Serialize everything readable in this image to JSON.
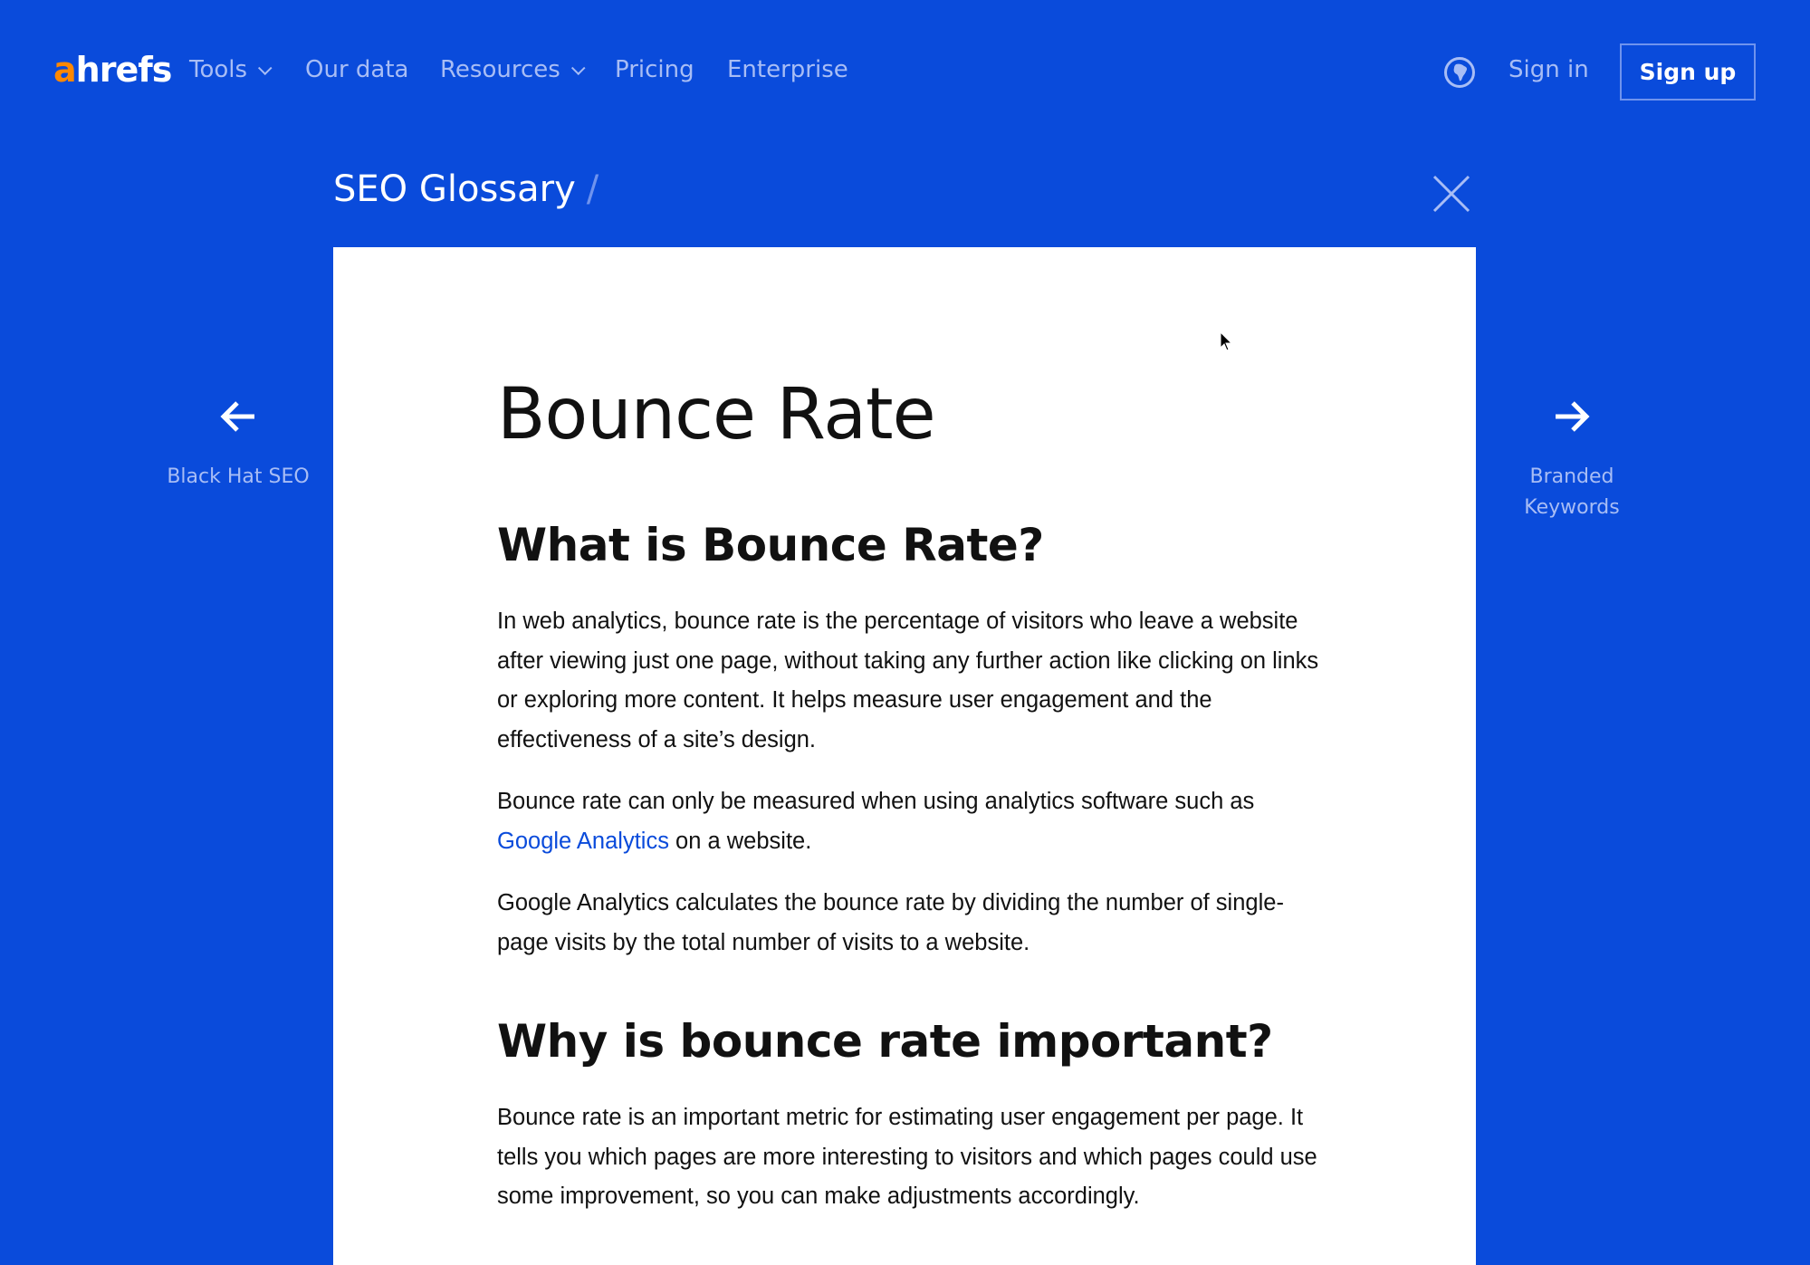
{
  "header": {
    "logo": {
      "accent_letter": "a",
      "rest": "hrefs"
    },
    "nav": [
      {
        "label": "Tools",
        "has_dropdown": true
      },
      {
        "label": "Our data",
        "has_dropdown": false
      },
      {
        "label": "Resources",
        "has_dropdown": true
      },
      {
        "label": "Pricing",
        "has_dropdown": false
      },
      {
        "label": "Enterprise",
        "has_dropdown": false
      }
    ],
    "language_icon": "globe-icon",
    "sign_in": "Sign in",
    "sign_up": "Sign up"
  },
  "glossary": {
    "breadcrumb": "SEO Glossary",
    "separator": "/",
    "close_icon": "close-icon"
  },
  "navigation": {
    "prev": {
      "label": "Black Hat SEO",
      "icon": "arrow-left-icon"
    },
    "next": {
      "label_line1": "Branded",
      "label_line2": "Keywords",
      "icon": "arrow-right-icon"
    }
  },
  "article": {
    "title": "Bounce Rate",
    "sections": [
      {
        "heading": "What is Bounce Rate?",
        "paragraphs": [
          "In web analytics, bounce rate is the percentage of visitors who leave a website after viewing just one page, without taking any further action like clicking on links or exploring more content. It helps measure user engagement and the effectiveness of a site’s design.",
          {
            "before": "Bounce rate can only be measured when using analytics software such as ",
            "link": "Google Analytics",
            "after": " on a website."
          },
          "Google Analytics calculates the bounce rate by dividing the number of single-page visits by the total number of visits to a website."
        ]
      },
      {
        "heading": "Why is bounce rate important?",
        "paragraphs": [
          "Bounce rate is an important metric for estimating user engagement per page. It tells you which pages are more interesting to visitors and which pages could use some improvement, so you can make adjustments accordingly."
        ]
      }
    ]
  },
  "colors": {
    "background": "#0a4bdb",
    "logo_accent": "#ff8800",
    "nav_text": "#a8bdf5",
    "link": "#0a4bdb",
    "card": "#ffffff"
  }
}
